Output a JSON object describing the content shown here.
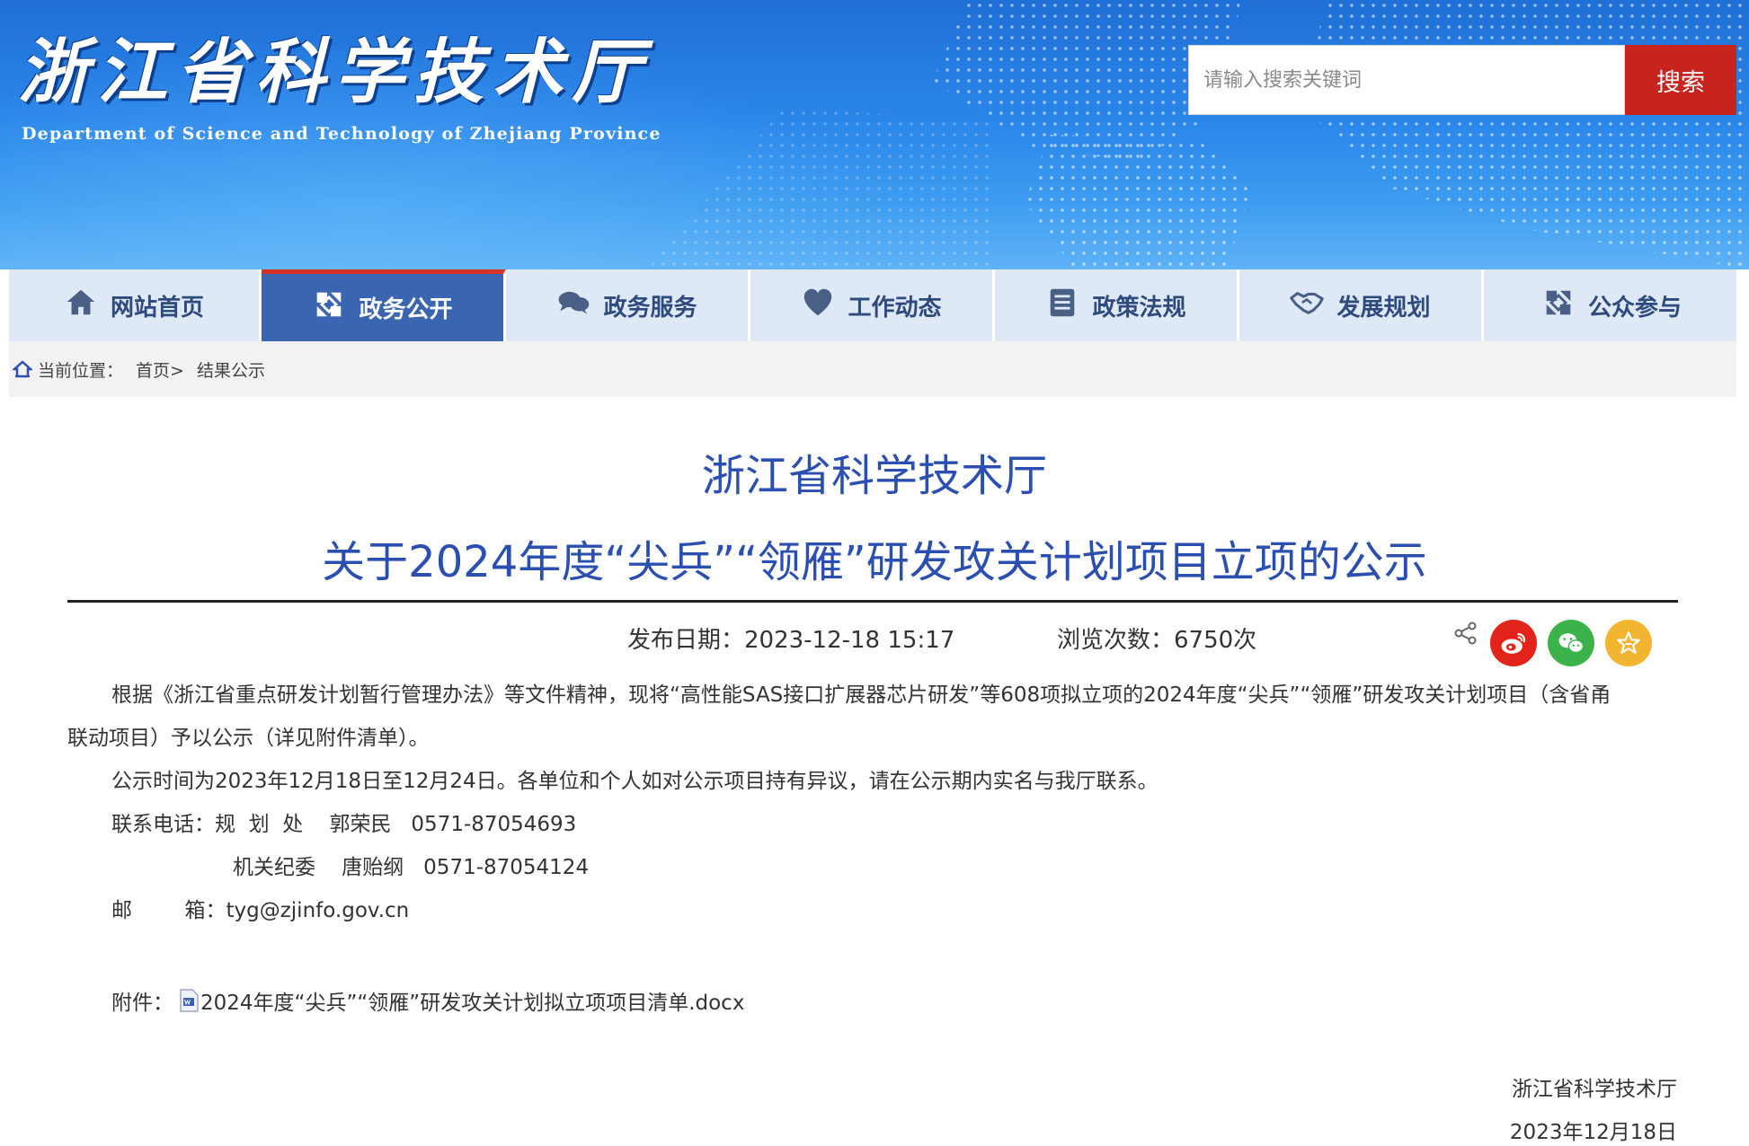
{
  "header": {
    "title_cn": "浙江省科学技术厅",
    "title_en": "Department of Science and Technology of Zhejiang Province",
    "search_placeholder": "请输入搜索关键词",
    "search_button": "搜索"
  },
  "nav": {
    "items": [
      {
        "label": "网站首页",
        "icon": "home-icon"
      },
      {
        "label": "政务公开",
        "icon": "gov-open-icon",
        "active": true
      },
      {
        "label": "政务服务",
        "icon": "chat-bubbles-icon"
      },
      {
        "label": "工作动态",
        "icon": "heart-icon"
      },
      {
        "label": "政策法规",
        "icon": "document-list-icon"
      },
      {
        "label": "发展规划",
        "icon": "handshake-icon"
      },
      {
        "label": "公众参与",
        "icon": "participation-icon"
      }
    ]
  },
  "breadcrumb": {
    "prefix": "当前位置：",
    "home": "首页>",
    "current": "结果公示"
  },
  "article": {
    "title_line1": "浙江省科学技术厅",
    "title_line2": "关于2024年度“尖兵”“领雁”研发攻关计划项目立项的公示",
    "publish_label": "发布日期：2023-12-18 15:17",
    "views_label": "浏览次数：6750次",
    "share_icons": [
      "share-icon",
      "weibo-icon",
      "wechat-icon",
      "favorite-icon"
    ],
    "colors": {
      "weibo": "#e2231a",
      "wechat": "#3bb34a",
      "favorite": "#f2b530",
      "title": "#2a4fb0"
    },
    "body_p1_line1": "根据《浙江省重点研发计划暂行管理办法》等文件精神，现将“高性能SAS接口扩展器芯片研发”等608项拟立项的2024年度“尖兵”“领雁”研发攻关计划项目（含省甬",
    "body_p1_line2": "联动项目）予以公示（详见附件清单）。",
    "body_p2": "公示时间为2023年12月18日至12月24日。各单位和个人如对公示项目持有异议，请在公示期内实名与我厅联系。",
    "contact_line1": "联系电话：规  划  处    郭荣民   0571-87054693",
    "contact_line2": "机关纪委    唐贻纲   0571-87054124",
    "email_line": "邮        箱：tyg@zjinfo.gov.cn",
    "attachment_label": "附件：",
    "attachment_file": "2024年度“尖兵”“领雁”研发攻关计划拟立项项目清单.docx",
    "signature_org": "浙江省科学技术厅",
    "signature_date": "2023年12月18日"
  }
}
